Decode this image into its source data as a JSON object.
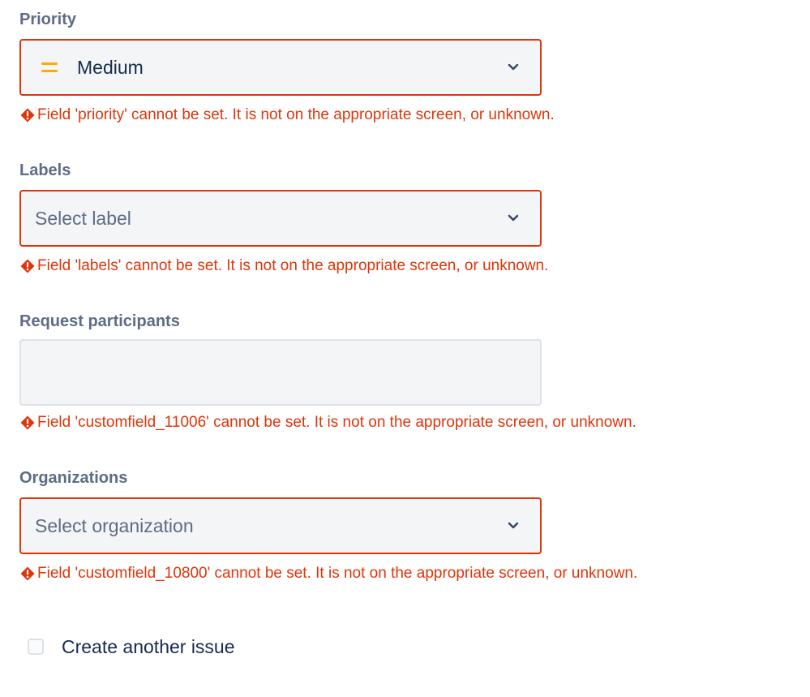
{
  "fields": {
    "priority": {
      "label": "Priority",
      "value": "Medium",
      "icon": "priority-medium-icon",
      "error": "Field 'priority' cannot be set. It is not on the appropriate screen, or unknown."
    },
    "labels": {
      "label": "Labels",
      "placeholder": "Select label",
      "error": "Field 'labels' cannot be set. It is not on the appropriate screen, or unknown."
    },
    "request_participants": {
      "label": "Request participants",
      "value": "",
      "error": "Field 'customfield_11006' cannot be set. It is not on the appropriate screen, or unknown."
    },
    "organizations": {
      "label": "Organizations",
      "placeholder": "Select organization",
      "error": "Field 'customfield_10800' cannot be set. It is not on the appropriate screen, or unknown."
    }
  },
  "create_another": {
    "label": "Create another issue",
    "checked": false
  },
  "colors": {
    "error": "#de350b",
    "label": "#5e6c84",
    "text": "#172b4d",
    "field_bg": "#f4f5f7",
    "priority_medium": "#ffab00"
  }
}
